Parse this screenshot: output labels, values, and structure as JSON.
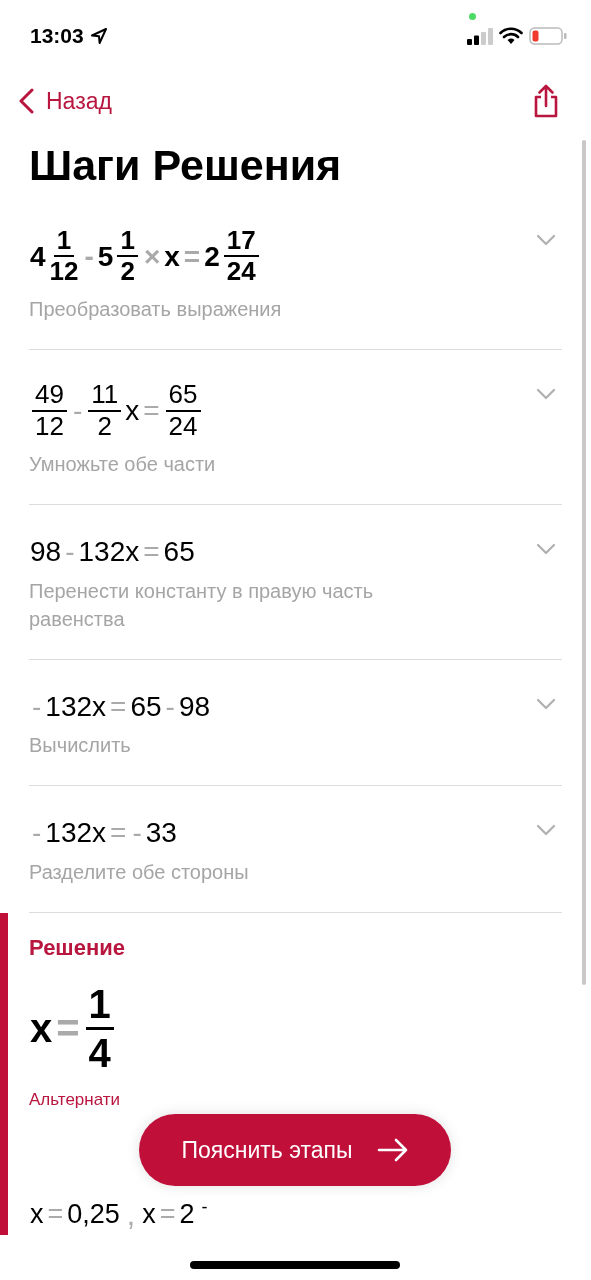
{
  "status_bar": {
    "time": "13:03"
  },
  "nav": {
    "back_label": "Назад"
  },
  "title": "Шаги Решения",
  "steps": [
    {
      "bold": true,
      "description": "Преобразовать выражения",
      "expression": [
        {
          "kind": "text",
          "t": "4"
        },
        {
          "kind": "frac",
          "num": "1",
          "den": "12"
        },
        {
          "kind": "op",
          "t": "-"
        },
        {
          "kind": "text",
          "t": "5"
        },
        {
          "kind": "frac",
          "num": "1",
          "den": "2"
        },
        {
          "kind": "op",
          "t": "×"
        },
        {
          "kind": "text",
          "t": "x"
        },
        {
          "kind": "op",
          "t": "="
        },
        {
          "kind": "text",
          "t": "2"
        },
        {
          "kind": "frac",
          "num": "17",
          "den": "24"
        }
      ]
    },
    {
      "bold": false,
      "description": "Умножьте обе части",
      "expression": [
        {
          "kind": "frac",
          "num": "49",
          "den": "12"
        },
        {
          "kind": "op",
          "t": "-"
        },
        {
          "kind": "frac",
          "num": "11",
          "den": "2"
        },
        {
          "kind": "text",
          "t": "x"
        },
        {
          "kind": "op",
          "t": "="
        },
        {
          "kind": "frac",
          "num": "65",
          "den": "24"
        }
      ]
    },
    {
      "bold": false,
      "description": "Перенести константу в правую часть равенства",
      "expression": [
        {
          "kind": "text",
          "t": "98"
        },
        {
          "kind": "op",
          "t": "-"
        },
        {
          "kind": "text",
          "t": "132x"
        },
        {
          "kind": "op",
          "t": "="
        },
        {
          "kind": "text",
          "t": "65"
        }
      ]
    },
    {
      "bold": false,
      "description": "Вычислить",
      "expression": [
        {
          "kind": "op",
          "t": "-"
        },
        {
          "kind": "text",
          "t": "132x"
        },
        {
          "kind": "op",
          "t": "="
        },
        {
          "kind": "text",
          "t": "65"
        },
        {
          "kind": "op",
          "t": "-"
        },
        {
          "kind": "text",
          "t": "98"
        }
      ]
    },
    {
      "bold": false,
      "description": "Разделите обе стороны",
      "expression": [
        {
          "kind": "op",
          "t": "-"
        },
        {
          "kind": "text",
          "t": "132x"
        },
        {
          "kind": "op",
          "t": "="
        },
        {
          "kind": "op",
          "t": "-"
        },
        {
          "kind": "text",
          "t": "33"
        }
      ]
    }
  ],
  "solution": {
    "heading": "Решение",
    "expression": [
      {
        "kind": "text",
        "t": "x"
      },
      {
        "kind": "op",
        "t": "="
      },
      {
        "kind": "frac",
        "num": "1",
        "den": "4"
      }
    ],
    "alternative_label": "Альтернати",
    "alternative_expression": [
      {
        "kind": "text",
        "t": "x"
      },
      {
        "kind": "op",
        "t": "="
      },
      {
        "kind": "text",
        "t": "0,25"
      },
      {
        "kind": "op",
        "t": ","
      },
      {
        "kind": "text",
        "t": "x"
      },
      {
        "kind": "op",
        "t": "="
      },
      {
        "kind": "text",
        "t": "2"
      },
      {
        "kind": "sup",
        "t": "-"
      }
    ]
  },
  "explain_button": {
    "label": "Пояснить этапы"
  }
}
